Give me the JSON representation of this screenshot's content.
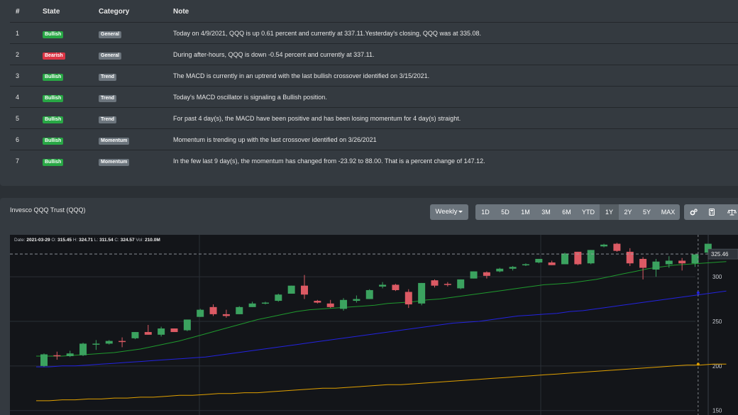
{
  "table": {
    "headers": [
      "#",
      "State",
      "Category",
      "Note"
    ],
    "rows": [
      {
        "num": "1",
        "state": "Bullish",
        "state_type": "bull",
        "category": "General",
        "note": "Today on 4/9/2021, QQQ is up 0.61 percent and currently at 337.11.Yesterday's closing, QQQ was at 335.08."
      },
      {
        "num": "2",
        "state": "Bearish",
        "state_type": "bear",
        "category": "General",
        "note": "During after-hours, QQQ is down -0.54 percent and currently at 337.11."
      },
      {
        "num": "3",
        "state": "Bullish",
        "state_type": "bull",
        "category": "Trend",
        "note": "The MACD is currently in an uptrend with the last bullish crossover identified on 3/15/2021."
      },
      {
        "num": "4",
        "state": "Bullish",
        "state_type": "bull",
        "category": "Trend",
        "note": "Today's MACD oscillator is signaling a Bullish position."
      },
      {
        "num": "5",
        "state": "Bullish",
        "state_type": "bull",
        "category": "Trend",
        "note": "For past 4 day(s), the MACD have been positive and has been losing momentum for 4 day(s) straight."
      },
      {
        "num": "6",
        "state": "Bullish",
        "state_type": "bull",
        "category": "Momentum",
        "note": "Momentum is trending up with the last crossover identified on 3/26/2021"
      },
      {
        "num": "7",
        "state": "Bullish",
        "state_type": "bull",
        "category": "Momentum",
        "note": "In the few last 9 day(s), the momentum has changed from -23.92 to 88.00. That is a percent change of 147.12."
      }
    ]
  },
  "chart_panel": {
    "title": "Invesco QQQ Trust (QQQ)",
    "interval_label": "Weekly",
    "ranges": [
      "1D",
      "5D",
      "1M",
      "3M",
      "6M",
      "YTD",
      "1Y",
      "2Y",
      "5Y",
      "MAX"
    ],
    "active_range": "1Y",
    "tools": [
      "gears-icon",
      "calculator-icon",
      "balance-scale-icon"
    ]
  },
  "legend": {
    "date_label": "Date:",
    "date": "2021-03-29",
    "o_label": "O:",
    "o": "315.45",
    "h_label": "H:",
    "h": "324.71",
    "l_label": "L:",
    "l": "311.54",
    "c_label": "C:",
    "c": "324.57",
    "vol_label": "Vol:",
    "vol": "210.0M"
  },
  "chart_data": {
    "type": "candlestick",
    "y_ticks": [
      "300",
      "250",
      "200",
      "150"
    ],
    "ylim": [
      145,
      347
    ],
    "last_price_label": "325.46",
    "last_price": 325.46,
    "candles": [
      {
        "o": 200,
        "h": 214,
        "l": 199,
        "c": 213
      },
      {
        "o": 212,
        "h": 216,
        "l": 207,
        "c": 211
      },
      {
        "o": 211,
        "h": 217,
        "l": 210,
        "c": 214
      },
      {
        "o": 212,
        "h": 226,
        "l": 211,
        "c": 225
      },
      {
        "o": 224,
        "h": 229,
        "l": 218,
        "c": 225
      },
      {
        "o": 225,
        "h": 229,
        "l": 224,
        "c": 228
      },
      {
        "o": 228,
        "h": 232,
        "l": 221,
        "c": 227
      },
      {
        "o": 231,
        "h": 238,
        "l": 230,
        "c": 238
      },
      {
        "o": 238,
        "h": 246,
        "l": 235,
        "c": 235
      },
      {
        "o": 235,
        "h": 244,
        "l": 233,
        "c": 242
      },
      {
        "o": 242,
        "h": 242,
        "l": 238,
        "c": 238
      },
      {
        "o": 240,
        "h": 252,
        "l": 239,
        "c": 252
      },
      {
        "o": 255,
        "h": 264,
        "l": 255,
        "c": 263
      },
      {
        "o": 266,
        "h": 269,
        "l": 256,
        "c": 258
      },
      {
        "o": 258,
        "h": 263,
        "l": 254,
        "c": 256
      },
      {
        "o": 258,
        "h": 267,
        "l": 258,
        "c": 266
      },
      {
        "o": 266,
        "h": 272,
        "l": 266,
        "c": 270
      },
      {
        "o": 271,
        "h": 272,
        "l": 269,
        "c": 271
      },
      {
        "o": 273,
        "h": 281,
        "l": 272,
        "c": 280
      },
      {
        "o": 281,
        "h": 290,
        "l": 281,
        "c": 290
      },
      {
        "o": 290,
        "h": 302,
        "l": 275,
        "c": 280
      },
      {
        "o": 273,
        "h": 274,
        "l": 270,
        "c": 271
      },
      {
        "o": 270,
        "h": 274,
        "l": 265,
        "c": 266
      },
      {
        "o": 264,
        "h": 276,
        "l": 262,
        "c": 274
      },
      {
        "o": 273,
        "h": 279,
        "l": 271,
        "c": 275
      },
      {
        "o": 275,
        "h": 286,
        "l": 275,
        "c": 285
      },
      {
        "o": 289,
        "h": 294,
        "l": 287,
        "c": 291
      },
      {
        "o": 291,
        "h": 292,
        "l": 284,
        "c": 285
      },
      {
        "o": 283,
        "h": 286,
        "l": 265,
        "c": 269
      },
      {
        "o": 270,
        "h": 293,
        "l": 268,
        "c": 293
      },
      {
        "o": 296,
        "h": 297,
        "l": 288,
        "c": 290
      },
      {
        "o": 292,
        "h": 294,
        "l": 289,
        "c": 291
      },
      {
        "o": 287,
        "h": 297,
        "l": 286,
        "c": 297
      },
      {
        "o": 298,
        "h": 306,
        "l": 298,
        "c": 306
      },
      {
        "o": 305,
        "h": 306,
        "l": 298,
        "c": 301
      },
      {
        "o": 306,
        "h": 310,
        "l": 305,
        "c": 309
      },
      {
        "o": 309,
        "h": 312,
        "l": 307,
        "c": 311
      },
      {
        "o": 313,
        "h": 315,
        "l": 312,
        "c": 314
      },
      {
        "o": 316,
        "h": 320,
        "l": 315,
        "c": 320
      },
      {
        "o": 316,
        "h": 318,
        "l": 313,
        "c": 313
      },
      {
        "o": 314,
        "h": 327,
        "l": 314,
        "c": 326
      },
      {
        "o": 328,
        "h": 328,
        "l": 313,
        "c": 314
      },
      {
        "o": 315,
        "h": 330,
        "l": 314,
        "c": 330
      },
      {
        "o": 334,
        "h": 337,
        "l": 333,
        "c": 336
      },
      {
        "o": 337,
        "h": 338,
        "l": 328,
        "c": 329
      },
      {
        "o": 328,
        "h": 332,
        "l": 312,
        "c": 315
      },
      {
        "o": 320,
        "h": 322,
        "l": 297,
        "c": 310
      },
      {
        "o": 308,
        "h": 320,
        "l": 300,
        "c": 317
      },
      {
        "o": 314,
        "h": 323,
        "l": 310,
        "c": 318
      },
      {
        "o": 318,
        "h": 321,
        "l": 307,
        "c": 315
      },
      {
        "o": 315,
        "h": 325,
        "l": 311,
        "c": 325
      },
      {
        "o": 327,
        "h": 337,
        "l": 326,
        "c": 337
      }
    ],
    "ma_green": [
      211,
      211,
      211,
      212,
      213,
      214,
      215,
      217,
      219,
      222,
      225,
      228,
      232,
      236,
      240,
      244,
      248,
      252,
      255,
      258,
      261,
      263,
      264,
      265,
      266,
      267,
      268,
      270,
      271,
      272,
      274,
      275,
      277,
      279,
      281,
      283,
      285,
      287,
      289,
      291,
      292,
      293,
      295,
      297,
      300,
      303,
      306,
      309,
      311,
      313,
      314,
      315,
      316,
      317
    ],
    "ma_blue": [
      199,
      199,
      200,
      200,
      201,
      202,
      203,
      204,
      205,
      206,
      207,
      208,
      209,
      210,
      212,
      214,
      216,
      218,
      220,
      222,
      224,
      226,
      228,
      230,
      232,
      234,
      236,
      238,
      240,
      242,
      244,
      246,
      248,
      249,
      250,
      252,
      254,
      256,
      257,
      258,
      259,
      261,
      262,
      264,
      266,
      268,
      270,
      272,
      274,
      276,
      278,
      280,
      282,
      284
    ],
    "ma_orange": [
      161,
      161,
      162,
      162,
      163,
      163,
      164,
      164,
      165,
      165,
      166,
      167,
      167,
      168,
      169,
      169,
      170,
      170,
      171,
      172,
      173,
      174,
      175,
      175,
      176,
      177,
      178,
      179,
      179,
      180,
      181,
      182,
      183,
      184,
      185,
      186,
      187,
      188,
      189,
      190,
      191,
      192,
      193,
      194,
      195,
      196,
      197,
      198,
      199,
      200,
      201,
      201,
      202,
      202
    ]
  },
  "colors": {
    "bull": "#3ba25f",
    "bear": "#dc5a64",
    "ma_green": "#1f9a2e",
    "ma_blue": "#2323e0",
    "ma_orange": "#e0a000",
    "grid": "#2a2e35"
  }
}
